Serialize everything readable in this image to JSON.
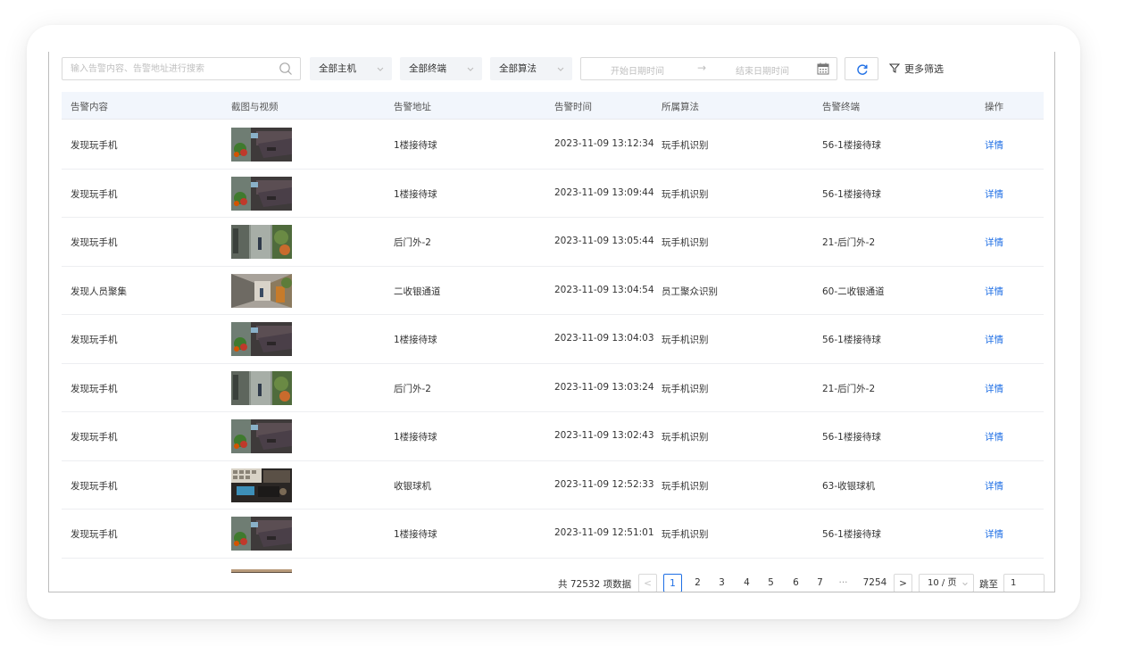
{
  "filters": {
    "search_placeholder": "输入告警内容、告警地址进行搜索",
    "host_select": "全部主机",
    "terminal_select": "全部终端",
    "algorithm_select": "全部算法",
    "start_date_placeholder": "开始日期时间",
    "end_date_placeholder": "结束日期时间",
    "date_arrow": "→",
    "more_filters": "更多筛选"
  },
  "table": {
    "columns": [
      "告警内容",
      "截图与视频",
      "告警地址",
      "告警时间",
      "所属算法",
      "告警终端",
      "操作"
    ],
    "rows": [
      {
        "content": "发现玩手机",
        "address": "1楼接待球",
        "time": "2023-11-09 13:12:34",
        "algorithm": "玩手机识别",
        "terminal": "56-1楼接待球",
        "action": "详情",
        "thumb": "reception"
      },
      {
        "content": "发现玩手机",
        "address": "1楼接待球",
        "time": "2023-11-09 13:09:44",
        "algorithm": "玩手机识别",
        "terminal": "56-1楼接待球",
        "action": "详情",
        "thumb": "reception"
      },
      {
        "content": "发现玩手机",
        "address": "后门外-2",
        "time": "2023-11-09 13:05:44",
        "algorithm": "玩手机识别",
        "terminal": "21-后门外-2",
        "action": "详情",
        "thumb": "backdoor"
      },
      {
        "content": "发现人员聚集",
        "address": "二收银通道",
        "time": "2023-11-09 13:04:54",
        "algorithm": "员工聚众识别",
        "terminal": "60-二收银通道",
        "action": "详情",
        "thumb": "corridor"
      },
      {
        "content": "发现玩手机",
        "address": "1楼接待球",
        "time": "2023-11-09 13:04:03",
        "algorithm": "玩手机识别",
        "terminal": "56-1楼接待球",
        "action": "详情",
        "thumb": "reception"
      },
      {
        "content": "发现玩手机",
        "address": "后门外-2",
        "time": "2023-11-09 13:03:24",
        "algorithm": "玩手机识别",
        "terminal": "21-后门外-2",
        "action": "详情",
        "thumb": "backdoor"
      },
      {
        "content": "发现玩手机",
        "address": "1楼接待球",
        "time": "2023-11-09 13:02:43",
        "algorithm": "玩手机识别",
        "terminal": "56-1楼接待球",
        "action": "详情",
        "thumb": "reception"
      },
      {
        "content": "发现玩手机",
        "address": "收银球机",
        "time": "2023-11-09 12:52:33",
        "algorithm": "玩手机识别",
        "terminal": "63-收银球机",
        "action": "详情",
        "thumb": "cashier"
      },
      {
        "content": "发现玩手机",
        "address": "1楼接待球",
        "time": "2023-11-09 12:51:01",
        "algorithm": "玩手机识别",
        "terminal": "56-1楼接待球",
        "action": "详情",
        "thumb": "reception"
      }
    ]
  },
  "pagination": {
    "total_text": "共 72532 项数据",
    "prev": "<",
    "pages": [
      "1",
      "2",
      "3",
      "4",
      "5",
      "6",
      "7"
    ],
    "current_page": "1",
    "ellipsis": "···",
    "last_page": "7254",
    "next": ">",
    "page_size": "10 / 页",
    "jump_label": "跳至",
    "jump_value": "1"
  },
  "colors": {
    "accent": "#1f6fe5",
    "header_bg": "#f2f6fc",
    "select_bg": "#f2f4f7"
  }
}
